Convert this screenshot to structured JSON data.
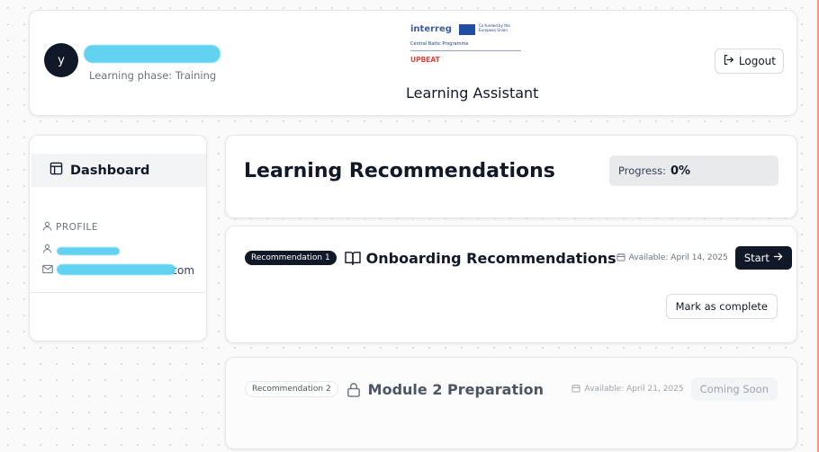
{
  "header": {
    "avatar_initial": "y",
    "learning_phase": "Learning phase: Training",
    "logo": {
      "program": "interreg",
      "cofunded": "Co-funded by the European Union",
      "subtitle": "Central Baltic Programme",
      "project": "UPBEAT"
    },
    "app_title": "Learning Assistant",
    "logout_label": "Logout"
  },
  "sidebar": {
    "dashboard_label": "Dashboard",
    "profile_label": "PROFILE",
    "email_suffix": "...com"
  },
  "main": {
    "title": "Learning Recommendations",
    "progress_label": "Progress:",
    "progress_value": "0%"
  },
  "recommendations": [
    {
      "badge": "Recommendation 1",
      "title": "Onboarding Recommendations",
      "available": "Available: April 14, 2025",
      "action": "Start",
      "secondary_action": "Mark as complete",
      "icon": "book-icon"
    },
    {
      "badge": "Recommendation 2",
      "title": "Module 2 Preparation",
      "available": "Available: April 21, 2025",
      "action": "Coming Soon",
      "icon": "lock-icon"
    }
  ],
  "colors": {
    "primary": "#111827",
    "redaction": "#5ad0f1",
    "upbeat": "#e0473a"
  }
}
